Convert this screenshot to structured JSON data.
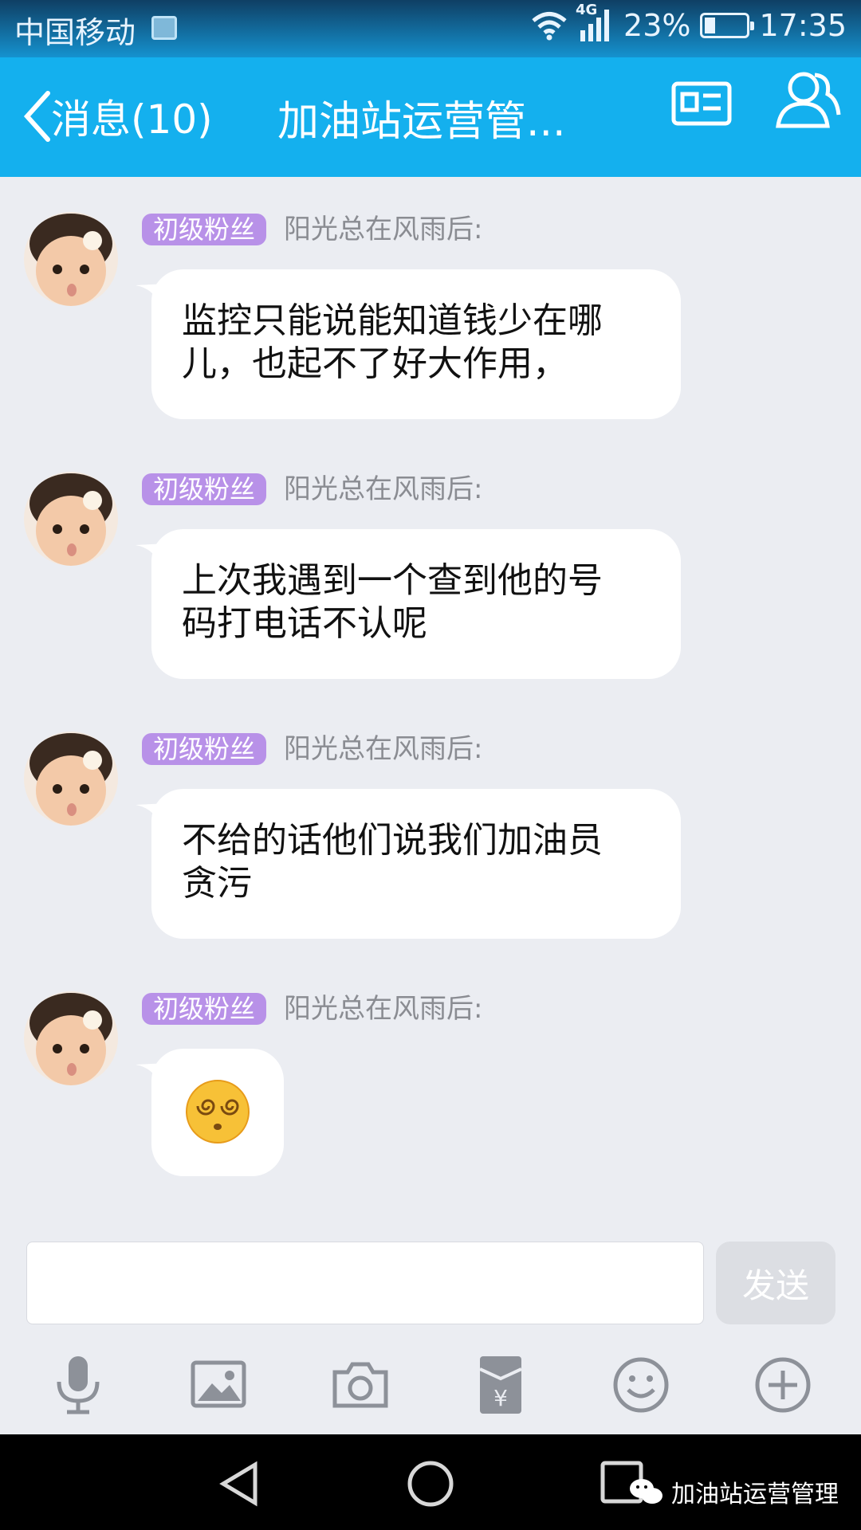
{
  "status_bar": {
    "carrier": "中国移动",
    "network": "4G",
    "battery": "23%",
    "battery_level": 0.23,
    "time": "17:35"
  },
  "header": {
    "back_label": "消息(10)",
    "title": "加油站运营管...",
    "profile_icon": "profile-card-icon",
    "group_icon": "group-members-icon"
  },
  "messages": [
    {
      "badge": "初级粉丝",
      "nick": "阳光总在风雨后:",
      "lines": [
        "监控只能说能知道钱少在哪",
        "儿，也起不了好大作用，"
      ]
    },
    {
      "badge": "初级粉丝",
      "nick": "阳光总在风雨后:",
      "lines": [
        "上次我遇到一个查到他的号",
        "码打电话不认呢"
      ]
    },
    {
      "badge": "初级粉丝",
      "nick": "阳光总在风雨后:",
      "lines": [
        "不给的话他们说我们加油员",
        "贪污"
      ]
    },
    {
      "badge": "初级粉丝",
      "nick": "阳光总在风雨后:",
      "emoji": "dizzy-face-emoji"
    }
  ],
  "input": {
    "value": "",
    "send_label": "发送"
  },
  "toolbar": [
    "microphone-icon",
    "image-icon",
    "camera-icon",
    "red-packet-icon",
    "smiley-icon",
    "plus-icon"
  ],
  "watermark": "加油站运营管理",
  "colors": {
    "header": "#14b0ee",
    "badge": "#b891e8",
    "background": "#ebedf2"
  }
}
